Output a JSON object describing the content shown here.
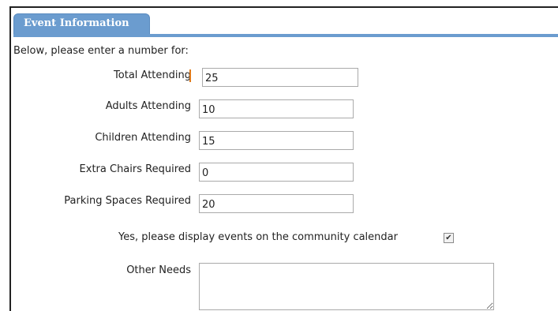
{
  "tab": {
    "label": "Event Information"
  },
  "form": {
    "intro": "Below, please enter a number for:",
    "total_attending": {
      "label": "Total Attending",
      "value": "25",
      "required": true
    },
    "adults_attending": {
      "label": "Adults Attending",
      "value": "10"
    },
    "children_attending": {
      "label": "Children Attending",
      "value": "15"
    },
    "extra_chairs": {
      "label": "Extra Chairs Required",
      "value": "0"
    },
    "parking_spaces": {
      "label": "Parking Spaces Required",
      "value": "20"
    },
    "community_calendar": {
      "label": "Yes, please display events on the community calendar",
      "checked": true,
      "mark": "✔"
    },
    "other_needs": {
      "label": "Other Needs",
      "value": ""
    }
  },
  "colors": {
    "tab": "#6b9ccf",
    "required_marker": "#e07a1a"
  }
}
